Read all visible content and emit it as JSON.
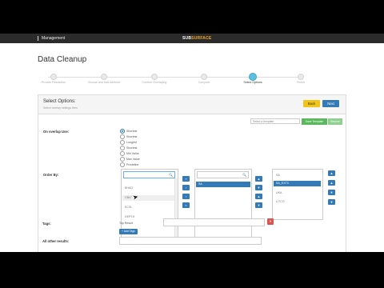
{
  "topbar": {
    "section": "Management",
    "logo_main": "SUB",
    "logo_accent": "SURFACE"
  },
  "page": {
    "title": "Data Cleanup"
  },
  "steps": [
    {
      "label": "Provide Resolution"
    },
    {
      "label": "Choose and Add Attribute"
    },
    {
      "label": "Confirm Overlaying"
    },
    {
      "label": "Compute"
    },
    {
      "label": "Select Options",
      "active": true
    },
    {
      "label": "Finish"
    }
  ],
  "panel": {
    "heading": "Select Options:",
    "subheading": "Select overlay settings then",
    "back_label": "Back",
    "next_label": "Next",
    "template_placeholder": "Select a template",
    "save_template_label": "Save Template",
    "restore_label": "Restore"
  },
  "overlay": {
    "label": "On overlap Use:",
    "options": [
      "Shortest",
      "Shortest",
      "Longest",
      "Shortest",
      "Min Value",
      "Max Value",
      "Predefine"
    ],
    "selected_index": 0
  },
  "order": {
    "label": "Order By:",
    "left_items": [
      "BHAO",
      "CBLT",
      "ECSL",
      "DEPTH"
    ],
    "left_highlight_index": 1,
    "middle_items": [
      "SA"
    ],
    "middle_selected_index": 0,
    "right_items": [
      "SA",
      "SA_EXTC",
      "UKA",
      "LITCO"
    ],
    "right_selected_index": 1,
    "left_buttons": [
      "»",
      "›",
      "‹",
      "«"
    ],
    "mid_buttons": [
      "▲",
      "▼",
      "▲",
      "▼"
    ],
    "right_buttons": [
      "▲",
      "▲",
      "▼",
      "▼"
    ]
  },
  "tags": {
    "label": "Tags:",
    "text": "Top Result",
    "add_label": "+ Add Tags",
    "delete_icon": "✕"
  },
  "other": {
    "label": "All other results:"
  }
}
